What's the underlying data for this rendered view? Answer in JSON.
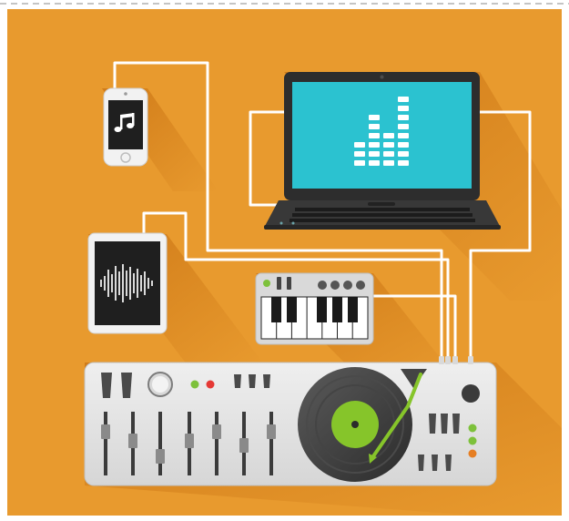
{
  "scene": {
    "icons": {
      "phone": "music-note-icon",
      "tablet": "waveform-icon",
      "laptop": "equalizer-icon",
      "keyboard": "midi-keyboard-icon",
      "controller": "dj-controller-icon"
    },
    "colors": {
      "background": "#E89A2E",
      "shadow": "#D7811D",
      "cable": "#FFFFFF",
      "device_light": "#E7E7E7",
      "device_dark": "#2E2E2E",
      "screen": "#2BC2D0",
      "vinyl_label": "#86C52A"
    }
  }
}
